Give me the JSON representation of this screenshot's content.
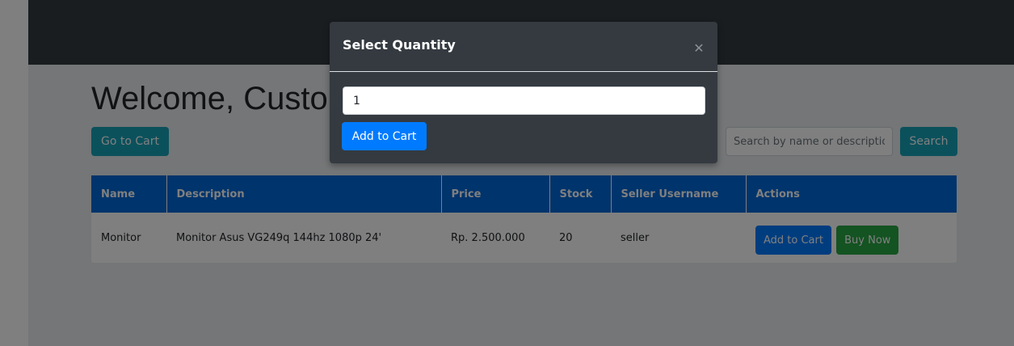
{
  "page": {
    "title": "Welcome, Customer"
  },
  "toolbar": {
    "go_to_cart": "Go to Cart",
    "search_placeholder": "Search by name or description",
    "search_label": "Search"
  },
  "table": {
    "columns": [
      "Name",
      "Description",
      "Price",
      "Stock",
      "Seller Username",
      "Actions"
    ],
    "rows": [
      {
        "name": "Monitor",
        "description": "Monitor Asus VG249q 144hz 1080p 24'",
        "price": "Rp. 2.500.000",
        "stock": "20",
        "seller": "seller",
        "add_to_cart": "Add to Cart",
        "buy_now": "Buy Now"
      }
    ]
  },
  "modal": {
    "title": "Select Quantity",
    "close_glyph": "✕",
    "quantity_value": "1",
    "add_to_cart": "Add to Cart"
  },
  "colors": {
    "navbar": "#343a40",
    "table_header": "#0069d9",
    "info": "#17a2b8",
    "primary": "#007bff",
    "success": "#28a745",
    "modal_bg": "#343a40"
  }
}
